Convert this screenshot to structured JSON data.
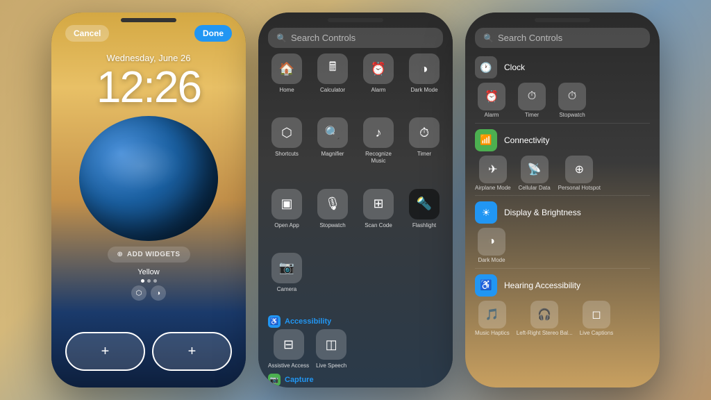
{
  "background": {
    "gradient": "warm amber to cool blue"
  },
  "phone1": {
    "cancel_label": "Cancel",
    "done_label": "Done",
    "date": "Wednesday, June 26",
    "time": "12:26",
    "add_widgets": "ADD WIDGETS",
    "theme": "Yellow",
    "left_btn": "+",
    "right_btn": "+"
  },
  "phone2": {
    "search_placeholder": "Search Controls",
    "controls": [
      {
        "label": "Home",
        "icon": "🏠"
      },
      {
        "label": "Calculator",
        "icon": "🖩"
      },
      {
        "label": "Alarm",
        "icon": "⏰"
      },
      {
        "label": "Dark Mode",
        "icon": "◑"
      },
      {
        "label": "Shortcuts",
        "icon": "⬡"
      },
      {
        "label": "Magnifier",
        "icon": "🔍"
      },
      {
        "label": "Recognize Music",
        "icon": "♪"
      },
      {
        "label": "Timer",
        "icon": "⏱"
      },
      {
        "label": "Open App",
        "icon": "▣"
      },
      {
        "label": "Stopwatch",
        "icon": "🎙"
      },
      {
        "label": "Scan Code",
        "icon": "⊞"
      },
      {
        "label": "Flashlight",
        "icon": "🔦"
      },
      {
        "label": "Camera",
        "icon": "📷"
      }
    ],
    "section_accessibility": "Accessibility",
    "accessibility_controls": [
      {
        "label": "Assistive Access",
        "icon": "⊟"
      },
      {
        "label": "Live Speech",
        "icon": "◫"
      }
    ],
    "section_capture": "Capture"
  },
  "phone3": {
    "search_placeholder": "Search Controls",
    "sections": [
      {
        "title": "Clock",
        "icon_color": "#555",
        "icon": "🕐",
        "items": [
          {
            "label": "Alarm",
            "icon": "⏰"
          },
          {
            "label": "Timer",
            "icon": "⏱"
          },
          {
            "label": "Stopwatch",
            "icon": "⏱"
          }
        ]
      },
      {
        "title": "Connectivity",
        "icon_color": "#4CAF50",
        "icon": "📶",
        "items": [
          {
            "label": "Airplane Mode",
            "icon": "✈"
          },
          {
            "label": "Cellular Data",
            "icon": "📡"
          },
          {
            "label": "Personal Hotspot",
            "icon": "⊕"
          }
        ]
      },
      {
        "title": "Display & Brightness",
        "icon_color": "#2196F3",
        "icon": "☀",
        "items": [
          {
            "label": "Dark Mode",
            "icon": "◑"
          }
        ]
      },
      {
        "title": "Hearing Accessibility",
        "icon_color": "#2196F3",
        "icon": "♿",
        "items": [
          {
            "label": "Music Haptics",
            "icon": "🎵"
          },
          {
            "label": "Left-Right Stereo Bal...",
            "icon": "🎧"
          },
          {
            "label": "Live Captions",
            "icon": "◻"
          }
        ]
      }
    ]
  }
}
